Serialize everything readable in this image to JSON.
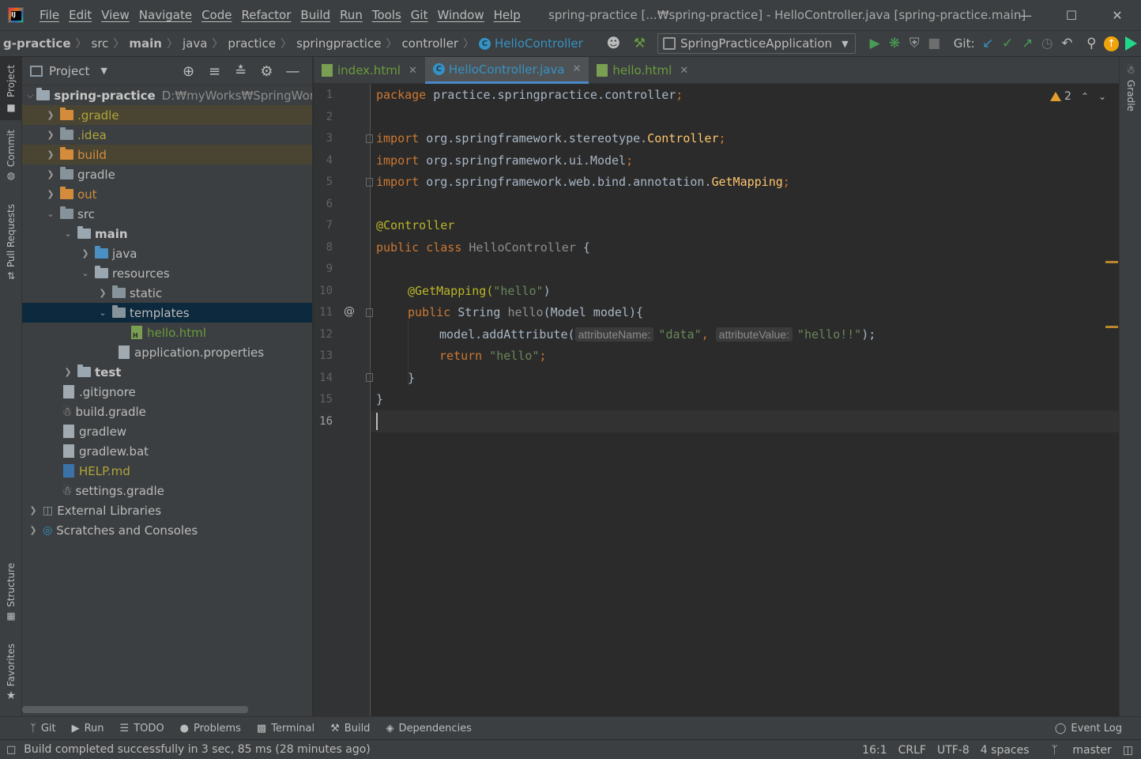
{
  "menu": {
    "items": [
      "File",
      "Edit",
      "View",
      "Navigate",
      "Code",
      "Refactor",
      "Build",
      "Run",
      "Tools",
      "Git",
      "Window",
      "Help"
    ]
  },
  "window": {
    "title": "spring-practice [...₩spring-practice] - HelloController.java [spring-practice.main]",
    "minimize": "—",
    "maximize": "☐",
    "close": "✕"
  },
  "breadcrumb": [
    "g-practice",
    "src",
    "main",
    "java",
    "practice",
    "springpractice",
    "controller",
    "HelloController"
  ],
  "toolbar": {
    "run_config": "SpringPracticeApplication",
    "git_label": "Git:"
  },
  "project_panel": {
    "title": "Project",
    "tree": [
      {
        "label": "spring-practice",
        "extra": "D:₩myWorks₩SpringWorks₩s",
        "type": "module"
      },
      {
        "label": ".gradle",
        "type": "folder"
      },
      {
        "label": ".idea",
        "type": "folder"
      },
      {
        "label": "build",
        "type": "folder"
      },
      {
        "label": "gradle",
        "type": "folder"
      },
      {
        "label": "out",
        "type": "folder"
      },
      {
        "label": "src",
        "type": "folder"
      },
      {
        "label": "main",
        "type": "folder"
      },
      {
        "label": "java",
        "type": "folder"
      },
      {
        "label": "resources",
        "type": "folder"
      },
      {
        "label": "static",
        "type": "folder"
      },
      {
        "label": "templates",
        "type": "folder"
      },
      {
        "label": "hello.html",
        "type": "file"
      },
      {
        "label": "application.properties",
        "type": "file"
      },
      {
        "label": "test",
        "type": "folder"
      },
      {
        "label": ".gitignore",
        "type": "file"
      },
      {
        "label": "build.gradle",
        "type": "file"
      },
      {
        "label": "gradlew",
        "type": "file"
      },
      {
        "label": "gradlew.bat",
        "type": "file"
      },
      {
        "label": "HELP.md",
        "type": "file"
      },
      {
        "label": "settings.gradle",
        "type": "file"
      },
      {
        "label": "External Libraries",
        "type": "lib"
      },
      {
        "label": "Scratches and Consoles",
        "type": "lib"
      }
    ]
  },
  "side_stripes": {
    "left": [
      "Project",
      "Commit",
      "Pull Requests",
      "Structure",
      "Favorites"
    ],
    "right": [
      "Gradle"
    ]
  },
  "tabs": [
    {
      "label": "index.html",
      "active": false
    },
    {
      "label": "HelloController.java",
      "active": true
    },
    {
      "label": "hello.html",
      "active": false
    }
  ],
  "editor": {
    "line_numbers": [
      "1",
      "2",
      "3",
      "4",
      "5",
      "6",
      "7",
      "8",
      "9",
      "10",
      "11",
      "12",
      "13",
      "14",
      "15",
      "16"
    ],
    "current_line": 16,
    "warning_count": "2",
    "gutter_marker": "@",
    "lines": {
      "l1_kw": "package",
      "l1_rest": " practice.springpractice.controller",
      "l1_semi": ";",
      "l3_kw": "import",
      "l3_pkg": " org.springframework.stereotype.",
      "l3_cls": "Controller",
      "l3_semi": ";",
      "l4_kw": "import",
      "l4_pkg": " org.springframework.ui.Model",
      "l4_semi": ";",
      "l5_kw": "import",
      "l5_pkg": " org.springframework.web.bind.annotation.",
      "l5_cls": "GetMapping",
      "l5_semi": ";",
      "l7_ann": "@Controller",
      "l8_kw": "public class",
      "l8_name": " HelloController",
      "l8_rest": " {",
      "l10_ann": "@GetMapping(",
      "l10_str": "\"hello\"",
      "l10_end": ")",
      "l11_kw": "public",
      "l11_type": " String ",
      "l11_name": "hello",
      "l11_rest": "(Model model){",
      "l12_call": "model.addAttribute(",
      "l12_hint1": "attributeName:",
      "l12_str1": "\"data\"",
      "l12_comma": ", ",
      "l12_hint2": "attributeValue:",
      "l12_str2": "\"hello!!\"",
      "l12_end": ");",
      "l13_kw": "return",
      "l13_str": " \"hello\"",
      "l13_semi": ";",
      "l14": "}",
      "l15": "}"
    }
  },
  "bottom_tools": [
    "Git",
    "Run",
    "TODO",
    "Problems",
    "Terminal",
    "Build",
    "Dependencies"
  ],
  "event_log": "Event Log",
  "status": {
    "message": "Build completed successfully in 3 sec, 85 ms (28 minutes ago)",
    "position": "16:1",
    "line_sep": "CRLF",
    "encoding": "UTF-8",
    "indent": "4 spaces",
    "branch": "master"
  }
}
